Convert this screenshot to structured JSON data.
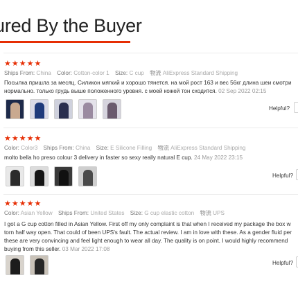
{
  "header": {
    "title": "ured By the Buyer"
  },
  "reviews": [
    {
      "stars": "★★★★★",
      "meta": [
        {
          "label": "Ships From:",
          "value": "China"
        },
        {
          "label": "Color:",
          "value": "Cotton-color 1"
        },
        {
          "label": "Size:",
          "value": "C cup"
        }
      ],
      "shipping_icon": "物流",
      "shipping": "AliExpress Standard Shipping",
      "text_lines": [
        "Посылка пришла за месяц. Силикон мягкий и хорошо тянется. на мой рост 163 и вес 56кг длина шеи смотри",
        "нормально. только грудь выше положенного уровня. с моей кожей тон сходится."
      ],
      "date": "02 Sep 2022 02:15",
      "photos": [
        "photo-1",
        "photo-2",
        "photo-3",
        "photo-4",
        "photo-5"
      ],
      "helpful": "Helpful?"
    },
    {
      "stars": "★★★★★",
      "meta": [
        {
          "label": "Color:",
          "value": "Color3"
        },
        {
          "label": "Ships From:",
          "value": "China"
        },
        {
          "label": "Size:",
          "value": "E Silicone Filling"
        }
      ],
      "shipping_icon": "物流",
      "shipping": "AliExpress Standard Shipping",
      "text_lines": [
        "molto bella ho preso colour 3 delivery in faster so sexy really natural E cup."
      ],
      "date": "24 May 2022 23:15",
      "photos": [
        "photo-1",
        "photo-2",
        "photo-3",
        "photo-4"
      ],
      "helpful": "Helpful?"
    },
    {
      "stars": "★★★★★",
      "meta": [
        {
          "label": "Color:",
          "value": "Asian Yellow"
        },
        {
          "label": "Ships From:",
          "value": "United States"
        },
        {
          "label": "Size:",
          "value": "G cup elastic cotton"
        }
      ],
      "shipping_icon": "物流",
      "shipping": "UPS",
      "text_lines": [
        "I got a G cup cotton filled in Asian Yellow. First off my only complaint is that when I received my package the box w",
        "torn half way open. That could of been UPS's fault. The actual review. I am in love with these. As a gender fluid per",
        "these are very convincing and feel light enough to wear all day. The quality is on point. I would highly recommend",
        "buying from this seller."
      ],
      "date": "03 Mar 2022 17:08",
      "photos": [
        "photo-1",
        "photo-2"
      ],
      "helpful": "Helpful?"
    }
  ]
}
